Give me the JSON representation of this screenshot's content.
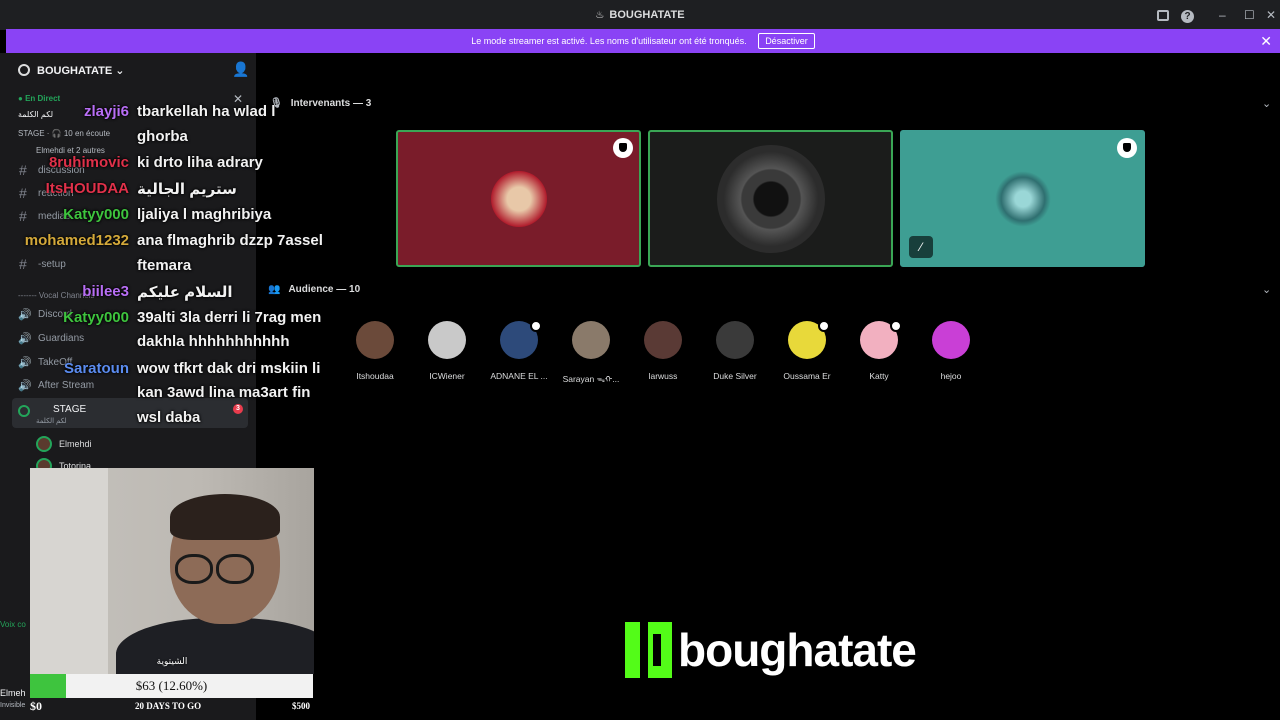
{
  "window": {
    "title": "BOUGHATATE",
    "controls": {
      "minimize": "–",
      "maximize": "☐",
      "close": "✕"
    },
    "help": "?"
  },
  "banner": {
    "message": "Le mode streamer est activé. Les noms d'utilisateur ont été tronqués.",
    "button": "Désactiver",
    "close": "✕",
    "color": "#8a43f5"
  },
  "sidebar": {
    "server_name": "BOUGHATATE",
    "live_label": "En Direct",
    "live_title": "لكم الكلمة",
    "stage_info": "STAGE · 🎧 10 en écoute",
    "listeners": "Elmehdi et 2 autres",
    "channels": [
      {
        "label": "discussion",
        "type": "text"
      },
      {
        "label": "reaction",
        "type": "text"
      },
      {
        "label": "medias",
        "type": "text"
      },
      {
        "label": "-setup",
        "type": "text"
      }
    ],
    "vocal_category": "------- Vocal Channels",
    "voice_channels": [
      {
        "label": "Discord"
      },
      {
        "label": "Guardians"
      },
      {
        "label": "TakeOff"
      },
      {
        "label": "After Stream"
      }
    ],
    "stage": {
      "label": "STAGE",
      "sub": "لكم الكلمة",
      "badge": "3"
    },
    "members": [
      "Elmehdi",
      "Totorina"
    ],
    "voice_connected": "Voix co",
    "user_name": "Elmeh",
    "user_status": "Invisible"
  },
  "chat": [
    {
      "user": "zlayji6",
      "color": "#b86ef5",
      "lines": [
        "tbarkellah ha wlad l",
        "ghorba"
      ]
    },
    {
      "user": "8ruhimovic",
      "color": "#e0314a",
      "lines": [
        "ki drto liha adrary"
      ]
    },
    {
      "user": "ItsHOUDAA",
      "color": "#e0314a",
      "lines": [
        "ستريم الجالية"
      ]
    },
    {
      "user": "Katyy000",
      "color": "#3ec43e",
      "lines": [
        "ljaliya l maghribiya"
      ]
    },
    {
      "user": "mohamed1232",
      "color": "#d4a93a",
      "lines": [
        "ana flmaghrib dzzp 7assel",
        "ftemara"
      ]
    },
    {
      "user": "biilee3",
      "color": "#b86ef5",
      "lines": [
        "السلام عليكم"
      ]
    },
    {
      "user": "Katyy000",
      "color": "#3ec43e",
      "lines": [
        "39alti 3la derri li 7rag men",
        "dakhla hhhhhhhhhhh"
      ]
    },
    {
      "user": "Saratoun",
      "color": "#5b8cf0",
      "lines": [
        "wow tfkrt dak dri mskiin li",
        "kan 3awd lina ma3art fin",
        "wsl daba"
      ]
    }
  ],
  "stage": {
    "speakers_header": "Intervenants — 3",
    "audience_header": "Audience — 10",
    "speakers": [
      {
        "bg": "#7a1c2a",
        "has_shield": true,
        "muted": false
      },
      {
        "bg": "#1b1c1b",
        "has_shield": false,
        "muted": false
      },
      {
        "bg": "#3e9e93",
        "has_shield": true,
        "muted": true
      }
    ],
    "audience": [
      {
        "name": "Itshoudaa",
        "color": "#6b4a3a",
        "shield": false
      },
      {
        "name": "ICWiener",
        "color": "#c9c9c9",
        "shield": false
      },
      {
        "name": "ADNANE EL ...",
        "color": "#2d4a7a",
        "shield": true
      },
      {
        "name": "Sarayan ᯓᡣ...",
        "color": "#8a7a6a",
        "shield": false
      },
      {
        "name": "larwuss",
        "color": "#5a3a35",
        "shield": false
      },
      {
        "name": "Duke Silver",
        "color": "#3a3a3a",
        "shield": false
      },
      {
        "name": "Oussama Er",
        "color": "#e8d93a",
        "shield": true
      },
      {
        "name": "Katty",
        "color": "#f2b0c0",
        "shield": true
      },
      {
        "name": "hejoo",
        "color": "#c93fd6",
        "shield": false
      }
    ]
  },
  "webcam": {
    "caption": "الشيتوية"
  },
  "goal": {
    "text": "$63 (12.60%)",
    "progress": 0.126,
    "start": "$0",
    "days": "20 DAYS TO GO",
    "end": "$500",
    "fill_color": "#3ec43e"
  },
  "brand": {
    "name": "boughatate",
    "color": "#53fc18"
  }
}
